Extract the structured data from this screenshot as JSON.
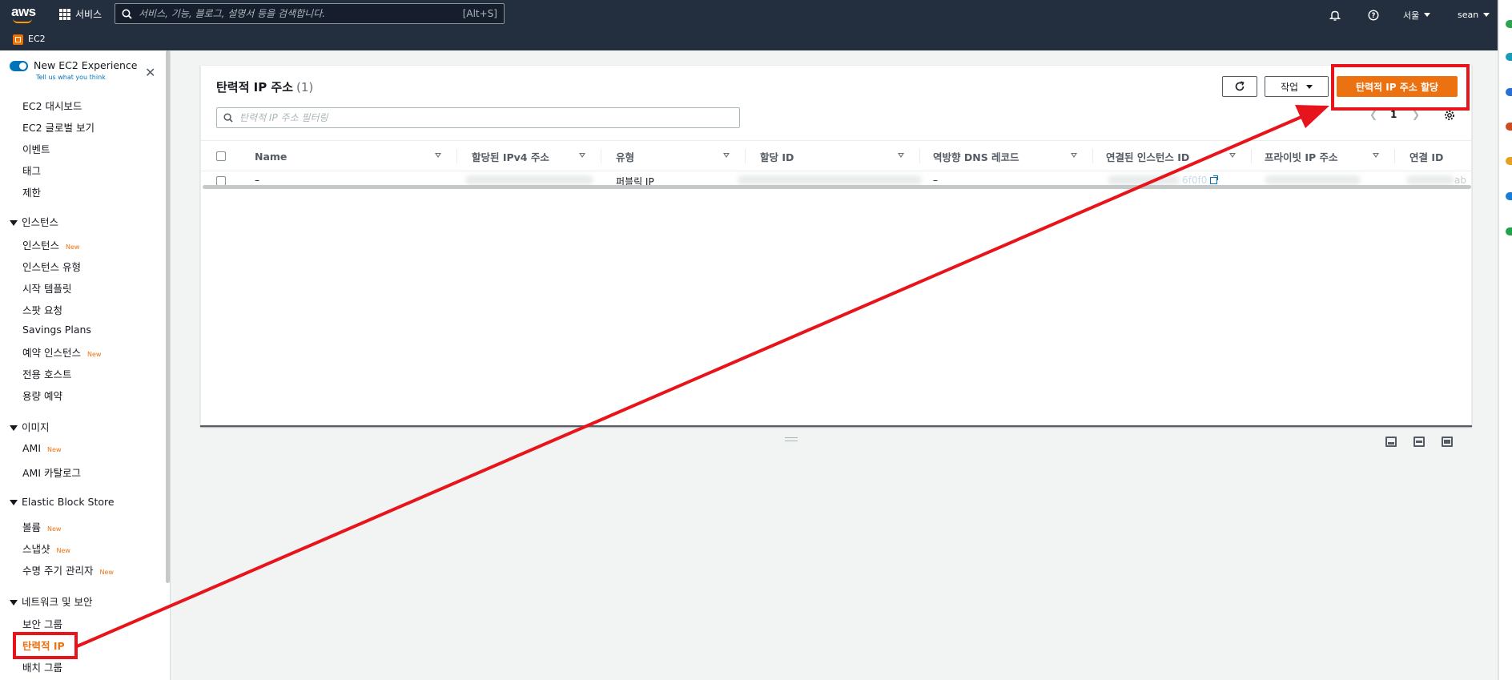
{
  "topnav": {
    "logo": "aws",
    "services_label": "서비스",
    "search_placeholder": "서비스, 기능, 블로그, 설명서 등을 검색합니다.",
    "search_shortcut": "[Alt+S]",
    "region": "서울",
    "user": "sean"
  },
  "subbar": {
    "service": "EC2"
  },
  "sidebar": {
    "experience_title": "New EC2 Experience",
    "experience_link": "Tell us what you think",
    "top_items": [
      "EC2 대시보드",
      "EC2 글로벌 보기",
      "이벤트",
      "태그",
      "제한"
    ],
    "sections": [
      {
        "title": "인스턴스",
        "items": [
          {
            "label": "인스턴스",
            "badge": "New"
          },
          {
            "label": "인스턴스 유형",
            "badge": ""
          },
          {
            "label": "시작 템플릿",
            "badge": ""
          },
          {
            "label": "스팟 요청",
            "badge": ""
          },
          {
            "label": "Savings Plans",
            "badge": ""
          },
          {
            "label": "예약 인스턴스",
            "badge": "New"
          },
          {
            "label": "전용 호스트",
            "badge": ""
          },
          {
            "label": "용량 예약",
            "badge": ""
          }
        ]
      },
      {
        "title": "이미지",
        "items": [
          {
            "label": "AMI",
            "badge": "New"
          },
          {
            "label": "AMI 카탈로그",
            "badge": ""
          }
        ]
      },
      {
        "title": "Elastic Block Store",
        "items": [
          {
            "label": "볼륨",
            "badge": "New"
          },
          {
            "label": "스냅샷",
            "badge": "New"
          },
          {
            "label": "수명 주기 관리자",
            "badge": "New"
          }
        ]
      },
      {
        "title": "네트워크 및 보안",
        "items": [
          {
            "label": "보안 그룹",
            "badge": ""
          },
          {
            "label": "탄력적 IP",
            "badge": ""
          },
          {
            "label": "배치 그룹",
            "badge": ""
          }
        ]
      }
    ]
  },
  "panel": {
    "title": "탄력적 IP 주소",
    "count": "(1)",
    "actions_label": "작업",
    "allocate_label": "탄력적 IP 주소 할당",
    "filter_placeholder": "탄력적 IP 주소 필터링",
    "page": "1",
    "columns": [
      "Name",
      "할당된 IPv4 주소",
      "유형",
      "할당 ID",
      "역방향 DNS 레코드",
      "연결된 인스턴스 ID",
      "프라이빗 IP 주소",
      "연결 ID"
    ],
    "row": {
      "name": "–",
      "type": "퍼블릭 IP",
      "reverse_dns": "–",
      "instance_suffix": "6f0f0",
      "assoc_suffix": "ab"
    }
  },
  "colors": {
    "nav_bg": "#232f3e",
    "accent_orange": "#ec7211",
    "link_blue": "#0073bb",
    "annotation_red": "#e8141b"
  }
}
